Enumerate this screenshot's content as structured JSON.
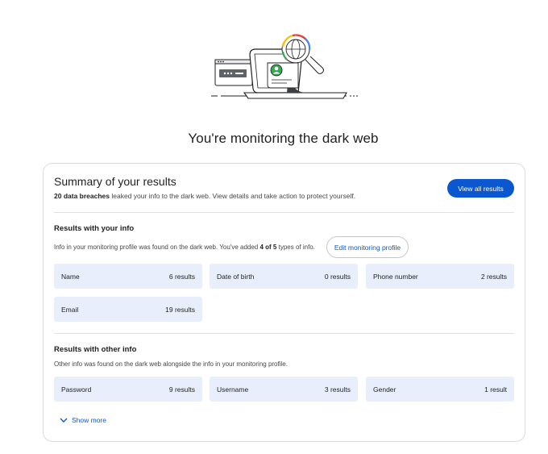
{
  "page_title": "You're monitoring the dark web",
  "summary": {
    "title": "Summary of your results",
    "count_text": "20 data breaches",
    "desc_rest": " leaked your info to the dark web. View details and take action to protect yourself.",
    "view_all_label": "View all results"
  },
  "with_your_info": {
    "title": "Results with your info",
    "desc_pre": "Info in your monitoring profile was found on the dark web. You've added ",
    "desc_bold": "4 of 5",
    "desc_post": " types of info.",
    "edit_label": "Edit monitoring profile",
    "items": [
      {
        "label": "Name",
        "value": "6 results"
      },
      {
        "label": "Date of birth",
        "value": "0 results"
      },
      {
        "label": "Phone number",
        "value": "2 results"
      },
      {
        "label": "Email",
        "value": "19 results"
      }
    ]
  },
  "other_info": {
    "title": "Results with other info",
    "desc": "Other info was found on the dark web alongside the info in your monitoring profile.",
    "items": [
      {
        "label": "Password",
        "value": "9 results"
      },
      {
        "label": "Username",
        "value": "3 results"
      },
      {
        "label": "Gender",
        "value": "1 result"
      }
    ],
    "show_more_label": "Show more"
  },
  "colors": {
    "accent": "#0b57d0",
    "tile_bg": "#e8eefc",
    "border": "#dadce0"
  }
}
